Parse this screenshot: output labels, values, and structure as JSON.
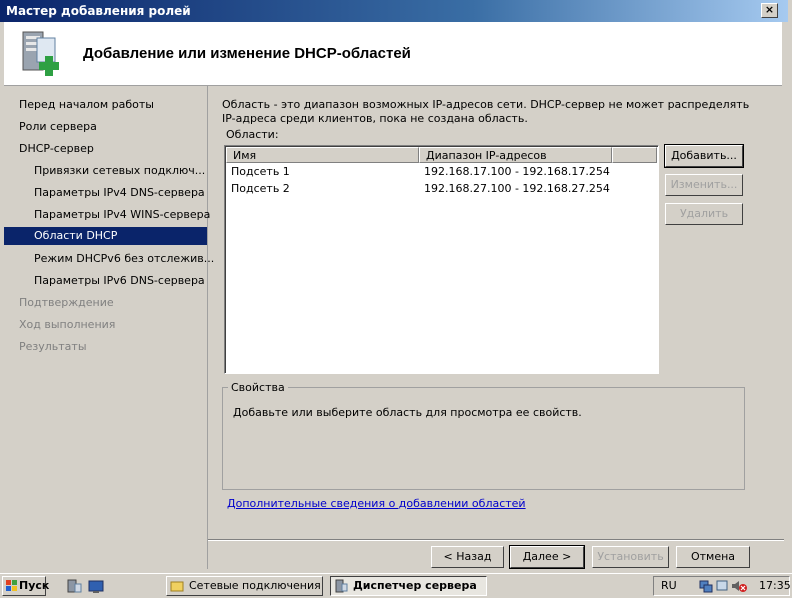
{
  "window": {
    "title": "Мастер добавления ролей",
    "close_glyph": "×"
  },
  "header": {
    "title": "Добавление или изменение DHCP-областей",
    "icon": "server-add-icon"
  },
  "nav": {
    "items": [
      {
        "label": "Перед началом работы",
        "level": 0,
        "state": "normal"
      },
      {
        "label": "Роли сервера",
        "level": 0,
        "state": "normal"
      },
      {
        "label": "DHCP-сервер",
        "level": 0,
        "state": "normal"
      },
      {
        "label": "Привязки сетевых подключ...",
        "level": 1,
        "state": "normal"
      },
      {
        "label": "Параметры IPv4 DNS-сервера",
        "level": 1,
        "state": "normal"
      },
      {
        "label": "Параметры IPv4 WINS-сервера",
        "level": 1,
        "state": "normal"
      },
      {
        "label": "Области DHCP",
        "level": 1,
        "state": "selected"
      },
      {
        "label": "Режим DHCPv6 без отслежив...",
        "level": 1,
        "state": "normal"
      },
      {
        "label": "Параметры IPv6 DNS-сервера",
        "level": 1,
        "state": "normal"
      },
      {
        "label": "Подтверждение",
        "level": 0,
        "state": "disabled"
      },
      {
        "label": "Ход выполнения",
        "level": 0,
        "state": "disabled"
      },
      {
        "label": "Результаты",
        "level": 0,
        "state": "disabled"
      }
    ]
  },
  "main": {
    "description": "Область - это диапазон возможных IP-адресов сети. DHCP-сервер не может распределять IP-адреса среди клиентов, пока не создана область.",
    "areas_label": "Области:",
    "columns": [
      "Имя",
      "Диапазон IP-адресов"
    ],
    "rows": [
      {
        "name": "Подсеть 1",
        "range": "192.168.17.100 - 192.168.17.254"
      },
      {
        "name": "Подсеть 2",
        "range": "192.168.27.100 - 192.168.27.254"
      }
    ],
    "buttons": {
      "add": "Добавить...",
      "edit": "Изменить...",
      "delete": "Удалить"
    },
    "properties": {
      "legend": "Свойства",
      "text": "Добавьте или выберите область для просмотра ее свойств."
    },
    "more_link": "Дополнительные сведения о добавлении областей"
  },
  "footer": {
    "back": "< Назад",
    "next": "Далее >",
    "install": "Установить",
    "cancel": "Отмена"
  },
  "taskbar": {
    "start": "Пуск",
    "tasks": [
      "Сетевые подключения",
      "Диспетчер сервера"
    ],
    "language": "RU",
    "time": "17:35"
  }
}
